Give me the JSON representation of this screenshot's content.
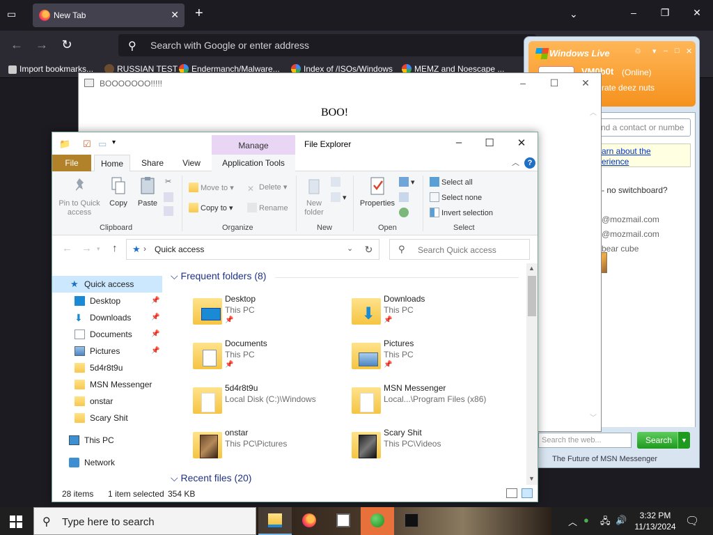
{
  "firefox": {
    "tab_title": "New Tab",
    "url_placeholder": "Search with Google or enter address",
    "bookmarks": [
      "Import bookmarks...",
      "RUSSIAN TEST",
      "Endermanch/Malware...",
      "Index of /ISOs/Windows",
      "MEMZ and Noescape ..."
    ]
  },
  "boo_dialog": {
    "title": "BOOOOOOO!!!!!",
    "message": "BOO!"
  },
  "msn": {
    "logo": "Windows Live",
    "username": "VM0b0t",
    "status": "(Online)",
    "personal_message": "rate deez nuts",
    "search_placeholder": "nd a contact or numbe",
    "link1": "arn about the",
    "link2": "erience",
    "switchboard_text": "- no switchboard?",
    "contact1": "@mozmail.com",
    "contact2": "@mozmail.com",
    "contact3": "bear cube",
    "web_search_placeholder": "Search the web...",
    "search_button": "Search",
    "footer": "The Future of MSN Messenger"
  },
  "explorer": {
    "title": "File Explorer",
    "manage": "Manage",
    "tabs": [
      "File",
      "Home",
      "Share",
      "View",
      "Application Tools"
    ],
    "ribbon": {
      "pin": "Pin to Quick access",
      "copy": "Copy",
      "paste": "Paste",
      "move_to": "Move to",
      "copy_to": "Copy to",
      "delete": "Delete",
      "rename": "Rename",
      "new_folder": "New folder",
      "properties": "Properties",
      "select_all": "Select all",
      "select_none": "Select none",
      "invert_selection": "Invert selection",
      "groups": [
        "Clipboard",
        "Organize",
        "New",
        "Open",
        "Select"
      ]
    },
    "address": "Quick access",
    "search_placeholder": "Search Quick access",
    "nav": [
      {
        "label": "Quick access"
      },
      {
        "label": "Desktop"
      },
      {
        "label": "Downloads"
      },
      {
        "label": "Documents"
      },
      {
        "label": "Pictures"
      },
      {
        "label": "5d4r8t9u"
      },
      {
        "label": "MSN Messenger"
      },
      {
        "label": "onstar"
      },
      {
        "label": "Scary Shit"
      },
      {
        "label": "This PC"
      },
      {
        "label": "Network"
      }
    ],
    "section_frequent": "Frequent folders (8)",
    "section_recent": "Recent files (20)",
    "folders": [
      {
        "name": "Desktop",
        "path": "This PC"
      },
      {
        "name": "Downloads",
        "path": "This PC"
      },
      {
        "name": "Documents",
        "path": "This PC"
      },
      {
        "name": "Pictures",
        "path": "This PC"
      },
      {
        "name": "5d4r8t9u",
        "path": "Local Disk (C:)\\Windows"
      },
      {
        "name": "MSN Messenger",
        "path": "Local...\\Program Files (x86)"
      },
      {
        "name": "onstar",
        "path": "This PC\\Pictures"
      },
      {
        "name": "Scary Shit",
        "path": "This PC\\Videos"
      }
    ],
    "status": {
      "items": "28 items",
      "selected": "1 item selected",
      "size": "354 KB"
    }
  },
  "taskbar": {
    "search_placeholder": "Type here to search",
    "time": "3:32 PM",
    "date": "11/13/2024"
  }
}
